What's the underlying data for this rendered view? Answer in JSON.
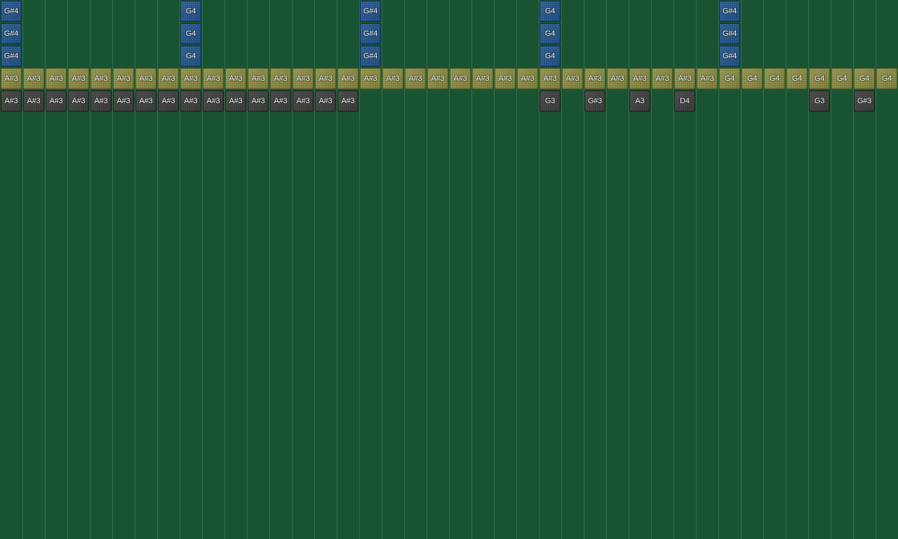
{
  "grid": {
    "columns": 40,
    "background": "#185432",
    "grid_line_color": "#4a8a63"
  },
  "colors": {
    "blue": "#1a4f86",
    "olive": "#7e7f35",
    "gray": "#3c3c3c",
    "label": "#ffffff"
  },
  "notes": [
    {
      "col": 0,
      "row": 0,
      "label": "G#4",
      "color": "blue"
    },
    {
      "col": 0,
      "row": 1,
      "label": "G#4",
      "color": "blue"
    },
    {
      "col": 0,
      "row": 2,
      "label": "G#4",
      "color": "blue"
    },
    {
      "col": 8,
      "row": 0,
      "label": "G4",
      "color": "blue"
    },
    {
      "col": 8,
      "row": 1,
      "label": "G4",
      "color": "blue"
    },
    {
      "col": 8,
      "row": 2,
      "label": "G4",
      "color": "blue"
    },
    {
      "col": 16,
      "row": 0,
      "label": "G#4",
      "color": "blue"
    },
    {
      "col": 16,
      "row": 1,
      "label": "G#4",
      "color": "blue"
    },
    {
      "col": 16,
      "row": 2,
      "label": "G#4",
      "color": "blue"
    },
    {
      "col": 24,
      "row": 0,
      "label": "G4",
      "color": "blue"
    },
    {
      "col": 24,
      "row": 1,
      "label": "G4",
      "color": "blue"
    },
    {
      "col": 24,
      "row": 2,
      "label": "G4",
      "color": "blue"
    },
    {
      "col": 32,
      "row": 0,
      "label": "G#4",
      "color": "blue"
    },
    {
      "col": 32,
      "row": 1,
      "label": "G#4",
      "color": "blue"
    },
    {
      "col": 32,
      "row": 2,
      "label": "G#4",
      "color": "blue"
    },
    {
      "col": 0,
      "row": 3,
      "label": "A#3",
      "color": "olive"
    },
    {
      "col": 1,
      "row": 3,
      "label": "A#3",
      "color": "olive"
    },
    {
      "col": 2,
      "row": 3,
      "label": "A#3",
      "color": "olive"
    },
    {
      "col": 3,
      "row": 3,
      "label": "A#3",
      "color": "olive"
    },
    {
      "col": 4,
      "row": 3,
      "label": "A#3",
      "color": "olive"
    },
    {
      "col": 5,
      "row": 3,
      "label": "A#3",
      "color": "olive"
    },
    {
      "col": 6,
      "row": 3,
      "label": "A#3",
      "color": "olive"
    },
    {
      "col": 7,
      "row": 3,
      "label": "A#3",
      "color": "olive"
    },
    {
      "col": 8,
      "row": 3,
      "label": "A#3",
      "color": "olive"
    },
    {
      "col": 9,
      "row": 3,
      "label": "A#3",
      "color": "olive"
    },
    {
      "col": 10,
      "row": 3,
      "label": "A#3",
      "color": "olive"
    },
    {
      "col": 11,
      "row": 3,
      "label": "A#3",
      "color": "olive"
    },
    {
      "col": 12,
      "row": 3,
      "label": "A#3",
      "color": "olive"
    },
    {
      "col": 13,
      "row": 3,
      "label": "A#3",
      "color": "olive"
    },
    {
      "col": 14,
      "row": 3,
      "label": "A#3",
      "color": "olive"
    },
    {
      "col": 15,
      "row": 3,
      "label": "A#3",
      "color": "olive"
    },
    {
      "col": 16,
      "row": 3,
      "label": "A#3",
      "color": "olive"
    },
    {
      "col": 17,
      "row": 3,
      "label": "A#3",
      "color": "olive"
    },
    {
      "col": 18,
      "row": 3,
      "label": "A#3",
      "color": "olive"
    },
    {
      "col": 19,
      "row": 3,
      "label": "A#3",
      "color": "olive"
    },
    {
      "col": 20,
      "row": 3,
      "label": "A#3",
      "color": "olive"
    },
    {
      "col": 21,
      "row": 3,
      "label": "A#3",
      "color": "olive"
    },
    {
      "col": 22,
      "row": 3,
      "label": "A#3",
      "color": "olive"
    },
    {
      "col": 23,
      "row": 3,
      "label": "A#3",
      "color": "olive"
    },
    {
      "col": 24,
      "row": 3,
      "label": "A#3",
      "color": "olive"
    },
    {
      "col": 25,
      "row": 3,
      "label": "A#3",
      "color": "olive"
    },
    {
      "col": 26,
      "row": 3,
      "label": "A#3",
      "color": "olive"
    },
    {
      "col": 27,
      "row": 3,
      "label": "A#3",
      "color": "olive"
    },
    {
      "col": 28,
      "row": 3,
      "label": "A#3",
      "color": "olive"
    },
    {
      "col": 29,
      "row": 3,
      "label": "A#3",
      "color": "olive"
    },
    {
      "col": 30,
      "row": 3,
      "label": "A#3",
      "color": "olive"
    },
    {
      "col": 31,
      "row": 3,
      "label": "A#3",
      "color": "olive"
    },
    {
      "col": 32,
      "row": 3,
      "label": "G4",
      "color": "olive"
    },
    {
      "col": 33,
      "row": 3,
      "label": "G4",
      "color": "olive"
    },
    {
      "col": 34,
      "row": 3,
      "label": "G4",
      "color": "olive"
    },
    {
      "col": 35,
      "row": 3,
      "label": "G4",
      "color": "olive"
    },
    {
      "col": 36,
      "row": 3,
      "label": "G4",
      "color": "olive"
    },
    {
      "col": 37,
      "row": 3,
      "label": "G4",
      "color": "olive"
    },
    {
      "col": 38,
      "row": 3,
      "label": "G4",
      "color": "olive"
    },
    {
      "col": 39,
      "row": 3,
      "label": "G4",
      "color": "olive"
    },
    {
      "col": 0,
      "row": 4,
      "label": "A#3",
      "color": "gray"
    },
    {
      "col": 1,
      "row": 4,
      "label": "A#3",
      "color": "gray"
    },
    {
      "col": 2,
      "row": 4,
      "label": "A#3",
      "color": "gray"
    },
    {
      "col": 3,
      "row": 4,
      "label": "A#3",
      "color": "gray"
    },
    {
      "col": 4,
      "row": 4,
      "label": "A#3",
      "color": "gray"
    },
    {
      "col": 5,
      "row": 4,
      "label": "A#3",
      "color": "gray"
    },
    {
      "col": 6,
      "row": 4,
      "label": "A#3",
      "color": "gray"
    },
    {
      "col": 7,
      "row": 4,
      "label": "A#3",
      "color": "gray"
    },
    {
      "col": 8,
      "row": 4,
      "label": "A#3",
      "color": "gray"
    },
    {
      "col": 9,
      "row": 4,
      "label": "A#3",
      "color": "gray"
    },
    {
      "col": 10,
      "row": 4,
      "label": "A#3",
      "color": "gray"
    },
    {
      "col": 11,
      "row": 4,
      "label": "A#3",
      "color": "gray"
    },
    {
      "col": 12,
      "row": 4,
      "label": "A#3",
      "color": "gray"
    },
    {
      "col": 13,
      "row": 4,
      "label": "A#3",
      "color": "gray"
    },
    {
      "col": 14,
      "row": 4,
      "label": "A#3",
      "color": "gray"
    },
    {
      "col": 15,
      "row": 4,
      "label": "A#3",
      "color": "gray"
    },
    {
      "col": 24,
      "row": 4,
      "label": "G3",
      "color": "gray"
    },
    {
      "col": 26,
      "row": 4,
      "label": "G#3",
      "color": "gray"
    },
    {
      "col": 28,
      "row": 4,
      "label": "A3",
      "color": "gray"
    },
    {
      "col": 30,
      "row": 4,
      "label": "D4",
      "color": "gray"
    },
    {
      "col": 36,
      "row": 4,
      "label": "G3",
      "color": "gray"
    },
    {
      "col": 38,
      "row": 4,
      "label": "G#3",
      "color": "gray"
    }
  ]
}
